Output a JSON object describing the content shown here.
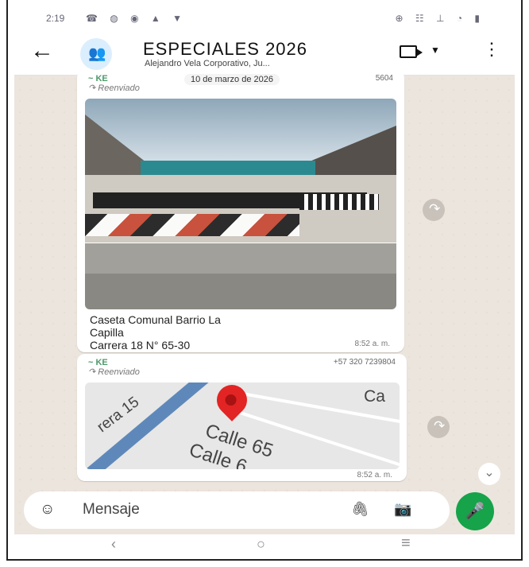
{
  "status": {
    "time": "2:19",
    "left_icons": "☎ ◍ ◉ ▲ ▼",
    "right_icons": "⊕ ☷ ⊥ ◔ ▮"
  },
  "header": {
    "title": "ESPECIALES 2026",
    "subtitle": "Alejandro Vela Corporativo, Ju..."
  },
  "messages": [
    {
      "sender": "~ KE",
      "forwarded": "↷ Reenviado",
      "date": "10 de marzo de 2026",
      "phone": "5604",
      "caption_lines": [
        "Caseta Comunal Barrio La",
        "Capilla",
        "Carrera 18 N° 65-30"
      ],
      "time": "8:52 a. m."
    },
    {
      "sender": "~ KE",
      "forwarded": "↷ Reenviado",
      "phone": "+57 320 7239804",
      "map_labels": [
        "rera 15",
        "Calle 65",
        "Calle 6",
        "Ca"
      ],
      "time": "8:52 a. m."
    }
  ],
  "composer": {
    "placeholder": "Mensaje"
  },
  "icons": {
    "back": "back-arrow-icon",
    "avatar": "group-avatar-icon",
    "video": "video-call-icon",
    "caret": "chevron-down-icon",
    "more": "more-vert-icon",
    "share": "forward-icon",
    "scroll": "chevron-down-double-icon",
    "emoji": "emoji-icon",
    "attach": "paperclip-icon",
    "camera": "camera-icon",
    "mic": "microphone-icon",
    "nav_back": "nav-back-icon",
    "nav_home": "nav-home-icon",
    "nav_recents": "nav-recents-icon"
  }
}
